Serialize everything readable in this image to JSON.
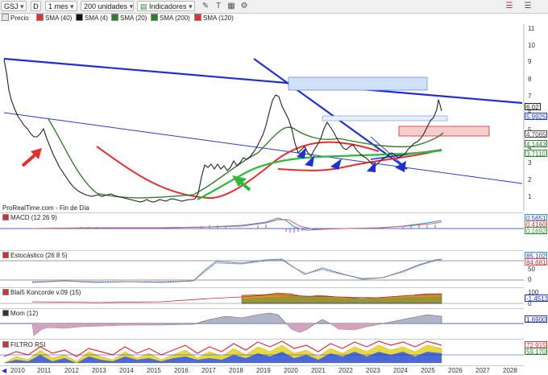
{
  "toolbar": {
    "ticker": "GSJ",
    "bars_glyph": "D",
    "timeframe": "1 mes",
    "units": "200 unidades",
    "indicators_label": "Indicadores"
  },
  "legend": [
    {
      "label": "Precio",
      "color": "#e6e6e6"
    },
    {
      "label": "SMA (40)",
      "color": "#e03030"
    },
    {
      "label": "SMA (4)",
      "color": "#111111"
    },
    {
      "label": "SMA (20)",
      "color": "#2f7d2f"
    },
    {
      "label": "SMA (200)",
      "color": "#2f7d2f"
    },
    {
      "label": "SMA (120)",
      "color": "#e03030"
    }
  ],
  "source_label": "ProRealTime.com - Fin de Día",
  "price_axis": [
    "11",
    "10",
    "9",
    "8",
    "7",
    "6",
    "5",
    "4",
    "3",
    "2",
    "1"
  ],
  "price_tags": [
    {
      "value": "6,02",
      "color": "#222222"
    },
    {
      "value": "5,9925",
      "color": "#1f3fbf"
    },
    {
      "value": "4,7065",
      "color": "#444444"
    },
    {
      "value": "4,1443",
      "color": "#2f7d2f"
    },
    {
      "value": "3,7110",
      "color": "#2f7d2f"
    }
  ],
  "panels": [
    {
      "title": "MACD (12 26 9)",
      "values": [
        "0,5651",
        "0,4160",
        "0,1692"
      ],
      "axis": []
    },
    {
      "title": "Estocástico (26 8 5)",
      "values": [
        "85,102",
        "84,681"
      ],
      "axis": [
        "50",
        "0"
      ]
    },
    {
      "title": "Blai5 Koncorde v.09 (15)",
      "values": [
        "-1,4513"
      ],
      "axis": [
        "100",
        "0"
      ]
    },
    {
      "title": "Mom (12)",
      "values": [
        "1,6900"
      ],
      "axis": []
    },
    {
      "title": "FILTRO RSI",
      "values": [
        "72,915",
        "59,170"
      ],
      "axis": []
    }
  ],
  "x_axis": [
    "2010",
    "2011",
    "2012",
    "2013",
    "2014",
    "2015",
    "2016",
    "2017",
    "2018",
    "2019",
    "2020",
    "2021",
    "2022",
    "2023",
    "2024",
    "2025",
    "2026",
    "2027",
    "2028"
  ],
  "colors": {
    "accent_blue": "#1f2fd0",
    "line_blue": "#2a3dcc",
    "red": "#e03030",
    "green": "#2fb83a",
    "candles": "#222222"
  }
}
